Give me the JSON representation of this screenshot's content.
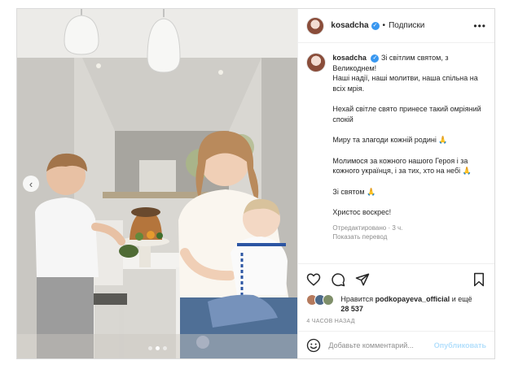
{
  "header": {
    "username": "kosadcha",
    "separator": "•",
    "follow_label": "Подписки",
    "more_icon": "more-options-icon",
    "verified_icon": "verified-badge-icon"
  },
  "caption": {
    "username": "kosadcha",
    "lines": [
      "Зі світлим святом, з Великоднем!\nНаші надії, наші молитви, наша спільна на всіх мрія.",
      "Нехай світле свято принесе такий омріяний спокій",
      "Миру та злагоди кожній родині 🙏",
      "Молимося за кожного нашого Героя і за кожного українця, і за тих, хто на небі 🙏",
      "Зі святом 🙏",
      "Христос воскрес!"
    ],
    "edited": "Отредактировано · 3 ч.",
    "translate": "Показать перевод"
  },
  "actions": {
    "like_icon": "heart-icon",
    "comment_icon": "comment-icon",
    "share_icon": "share-icon",
    "save_icon": "bookmark-icon"
  },
  "likes": {
    "prefix": "Нравится",
    "user": "podkopayeva_official",
    "suffix": "и ещё",
    "count": "28 537"
  },
  "time": "4 ЧАСОВ НАЗАД",
  "comment": {
    "emoji_icon": "emoji-icon",
    "placeholder": "Добавьте комментарий...",
    "publish": "Опубликовать"
  },
  "carousel": {
    "prev_icon": "chevron-left-icon",
    "dots_total": 3,
    "active_dot": 1
  },
  "colors": {
    "verified": "#3897f0",
    "publish_disabled": "#b2dffc",
    "border": "#dbdbdb",
    "muted": "#8e8e8e"
  }
}
